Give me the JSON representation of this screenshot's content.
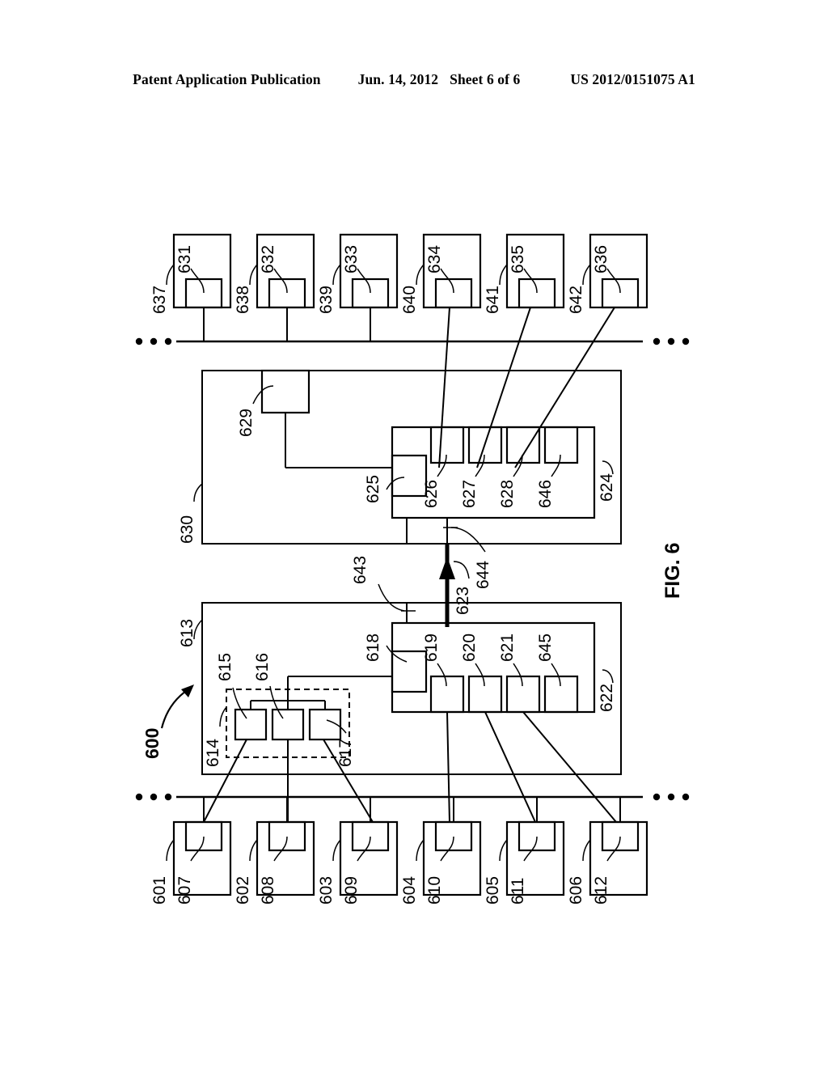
{
  "header": {
    "publication": "Patent Application Publication",
    "date": "Jun. 14, 2012",
    "sheet": "Sheet 6 of 6",
    "number": "US 2012/0151075 A1"
  },
  "figure": {
    "caption": "FIG. 6",
    "system_label": "600"
  },
  "top_row": {
    "outer_labels": [
      "637",
      "638",
      "639",
      "640",
      "641",
      "642"
    ],
    "inner_labels": [
      "631",
      "632",
      "633",
      "634",
      "635",
      "636"
    ]
  },
  "bottom_row": {
    "outer_labels": [
      "601",
      "602",
      "603",
      "604",
      "605",
      "606"
    ],
    "inner_labels": [
      "607",
      "608",
      "609",
      "610",
      "611",
      "612"
    ]
  },
  "upper_block": {
    "container_label": "630",
    "edge_module_label": "629",
    "inner_container_label": "624",
    "port_label": "625",
    "port_boxes": [
      "626",
      "627",
      "628",
      "646"
    ]
  },
  "lower_block": {
    "container_label": "613",
    "group_label": "614",
    "group_boxes": [
      "615",
      "616",
      "617"
    ],
    "port_label": "618",
    "inner_container_label": "622",
    "port_boxes": [
      "619",
      "620",
      "621",
      "645"
    ]
  },
  "link": {
    "arrow_label": "623",
    "lower_tap_label": "643",
    "upper_tap_label": "644"
  },
  "ellipsis": {
    "glyph": "•"
  }
}
